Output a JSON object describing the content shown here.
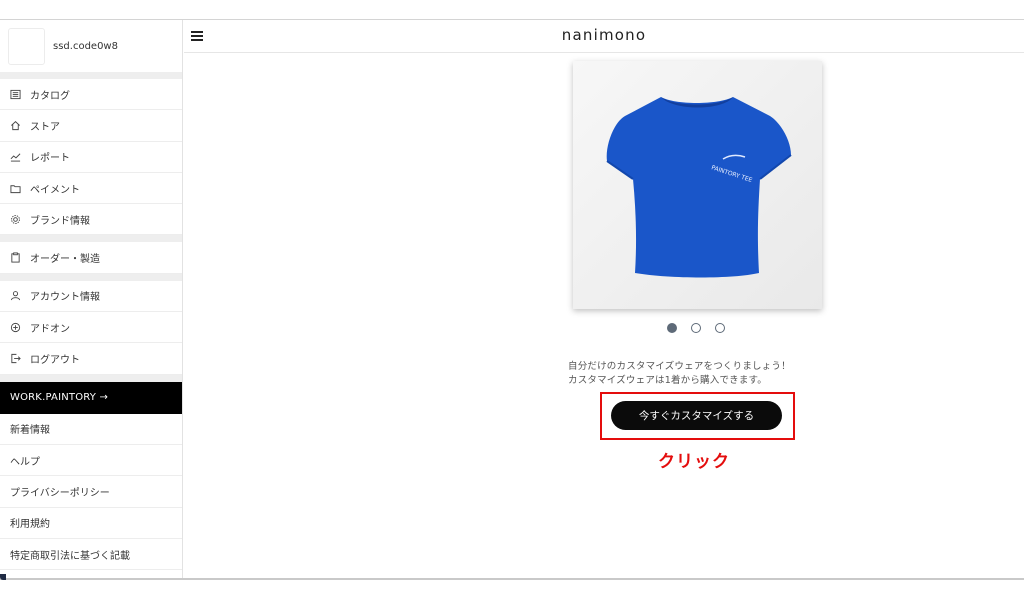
{
  "user": {
    "name": "ssd.code0w8"
  },
  "sidebar": {
    "group1": [
      {
        "label": "カタログ",
        "icon": "catalog-icon"
      },
      {
        "label": "ストア",
        "icon": "home-icon"
      },
      {
        "label": "レポート",
        "icon": "chart-icon"
      },
      {
        "label": "ペイメント",
        "icon": "folder-icon"
      },
      {
        "label": "ブランド情報",
        "icon": "gear-icon"
      }
    ],
    "group2": [
      {
        "label": "オーダー・製造",
        "icon": "clipboard-icon"
      }
    ],
    "group3": [
      {
        "label": "アカウント情報",
        "icon": "user-icon"
      },
      {
        "label": "アドオン",
        "icon": "plus-circle-icon"
      },
      {
        "label": "ログアウト",
        "icon": "logout-icon"
      }
    ],
    "work_banner": "WORK.PAINTORY →",
    "links": [
      "新着情報",
      "ヘルプ",
      "プライバシーポリシー",
      "利用規約",
      "特定商取引法に基づく記載"
    ]
  },
  "header": {
    "logo": "nanimono"
  },
  "product": {
    "shirt_color": "#1a56c9",
    "print_text": "PAINTORY TEE"
  },
  "carousel": {
    "count": 3,
    "active_index": 1
  },
  "description": {
    "line1": "自分だけのカスタマイズウェアをつくりましょう！",
    "line2": "カスタマイズウェアは1着から購入できます。"
  },
  "cta": {
    "label": "今すぐカスタマイズする"
  },
  "annotation": {
    "text": "クリック",
    "color": "#e40d0d"
  }
}
